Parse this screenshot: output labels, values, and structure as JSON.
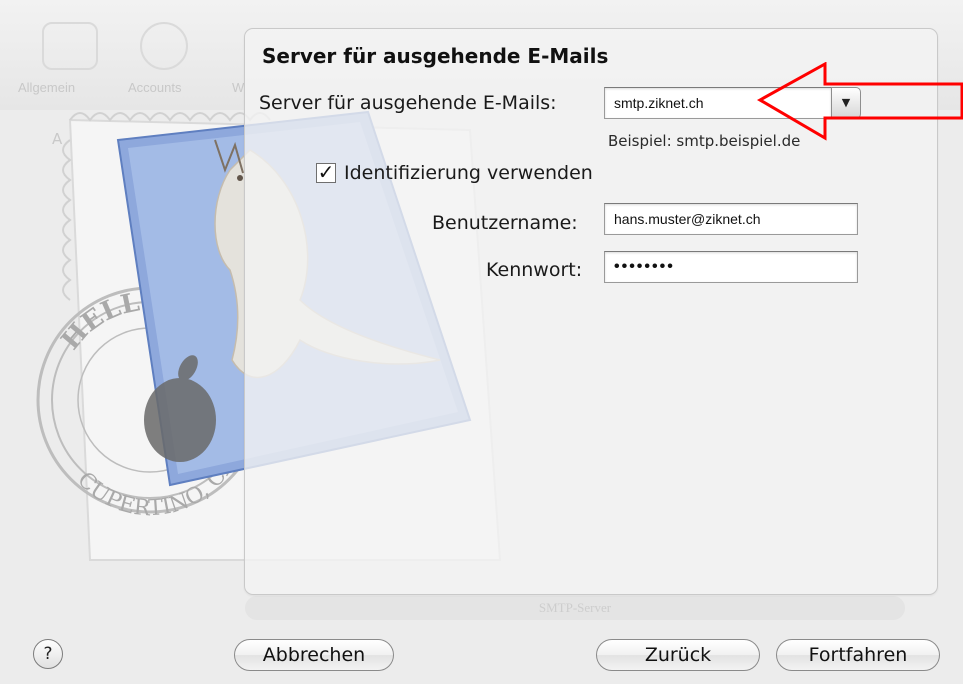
{
  "background": {
    "toolbar_items": [
      "Allgemein",
      "Accounts",
      "W"
    ],
    "faded_label": "A",
    "smtp_popup_label": "SMTP-Server"
  },
  "stamp": {
    "ring_text_top": "HELLO FR",
    "ring_text_bottom": "CUPERTINO, CA"
  },
  "sheet": {
    "title": "Server für ausgehende E-Mails",
    "server_label": "Server für ausgehende E-Mails:",
    "server_value": "smtp.ziknet.ch",
    "server_hint": "Beispiel: smtp.beispiel.de",
    "use_auth_label": "Identifizierung verwenden",
    "use_auth_checked": true,
    "use_auth_mark": "✓",
    "username_label": "Benutzername:",
    "username_value": "hans.muster@ziknet.ch",
    "password_label": "Kennwort:",
    "password_value": "••••••••"
  },
  "buttons": {
    "help": "?",
    "cancel": "Abbrechen",
    "back": "Zurück",
    "continue": "Fortfahren"
  },
  "annotation": {
    "arrow_color": "#ff0000"
  },
  "icons": {
    "combo": "chevron-down-icon"
  },
  "dropdown_glyph": "▼"
}
